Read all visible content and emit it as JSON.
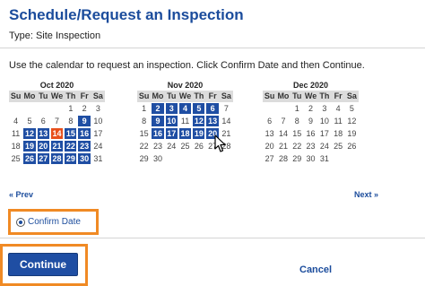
{
  "header": {
    "title": "Schedule/Request an Inspection",
    "type_line": "Type: Site Inspection"
  },
  "instructions": "Use the calendar to request an inspection. Click Confirm Date and then Continue.",
  "calendars": [
    {
      "month": "Oct 2020",
      "weekdays": [
        "Su",
        "Mo",
        "Tu",
        "We",
        "Th",
        "Fr",
        "Sa"
      ],
      "lead_blanks": 4,
      "days": 31,
      "available": [
        9,
        12,
        13,
        15,
        16,
        19,
        20,
        21,
        22,
        23,
        26,
        27,
        28,
        29,
        30
      ],
      "today": 14
    },
    {
      "month": "Nov 2020",
      "weekdays": [
        "Su",
        "Mo",
        "Tu",
        "We",
        "Th",
        "Fr",
        "Sa"
      ],
      "lead_blanks": 0,
      "days": 30,
      "available": [
        2,
        3,
        4,
        5,
        6,
        9,
        10,
        12,
        13,
        16,
        17,
        18,
        19,
        20
      ],
      "today": null
    },
    {
      "month": "Dec 2020",
      "weekdays": [
        "Su",
        "Mo",
        "Tu",
        "We",
        "Th",
        "Fr",
        "Sa"
      ],
      "lead_blanks": 2,
      "days": 31,
      "available": [],
      "today": null
    }
  ],
  "nav": {
    "prev": "« Prev",
    "next": "Next »"
  },
  "confirm": {
    "label": "Confirm Date"
  },
  "actions": {
    "continue": "Continue",
    "cancel": "Cancel"
  },
  "colors": {
    "accent": "#1b4c9c",
    "available": "#1f4ea3",
    "today": "#e8501c",
    "highlight": "#f08a24"
  }
}
